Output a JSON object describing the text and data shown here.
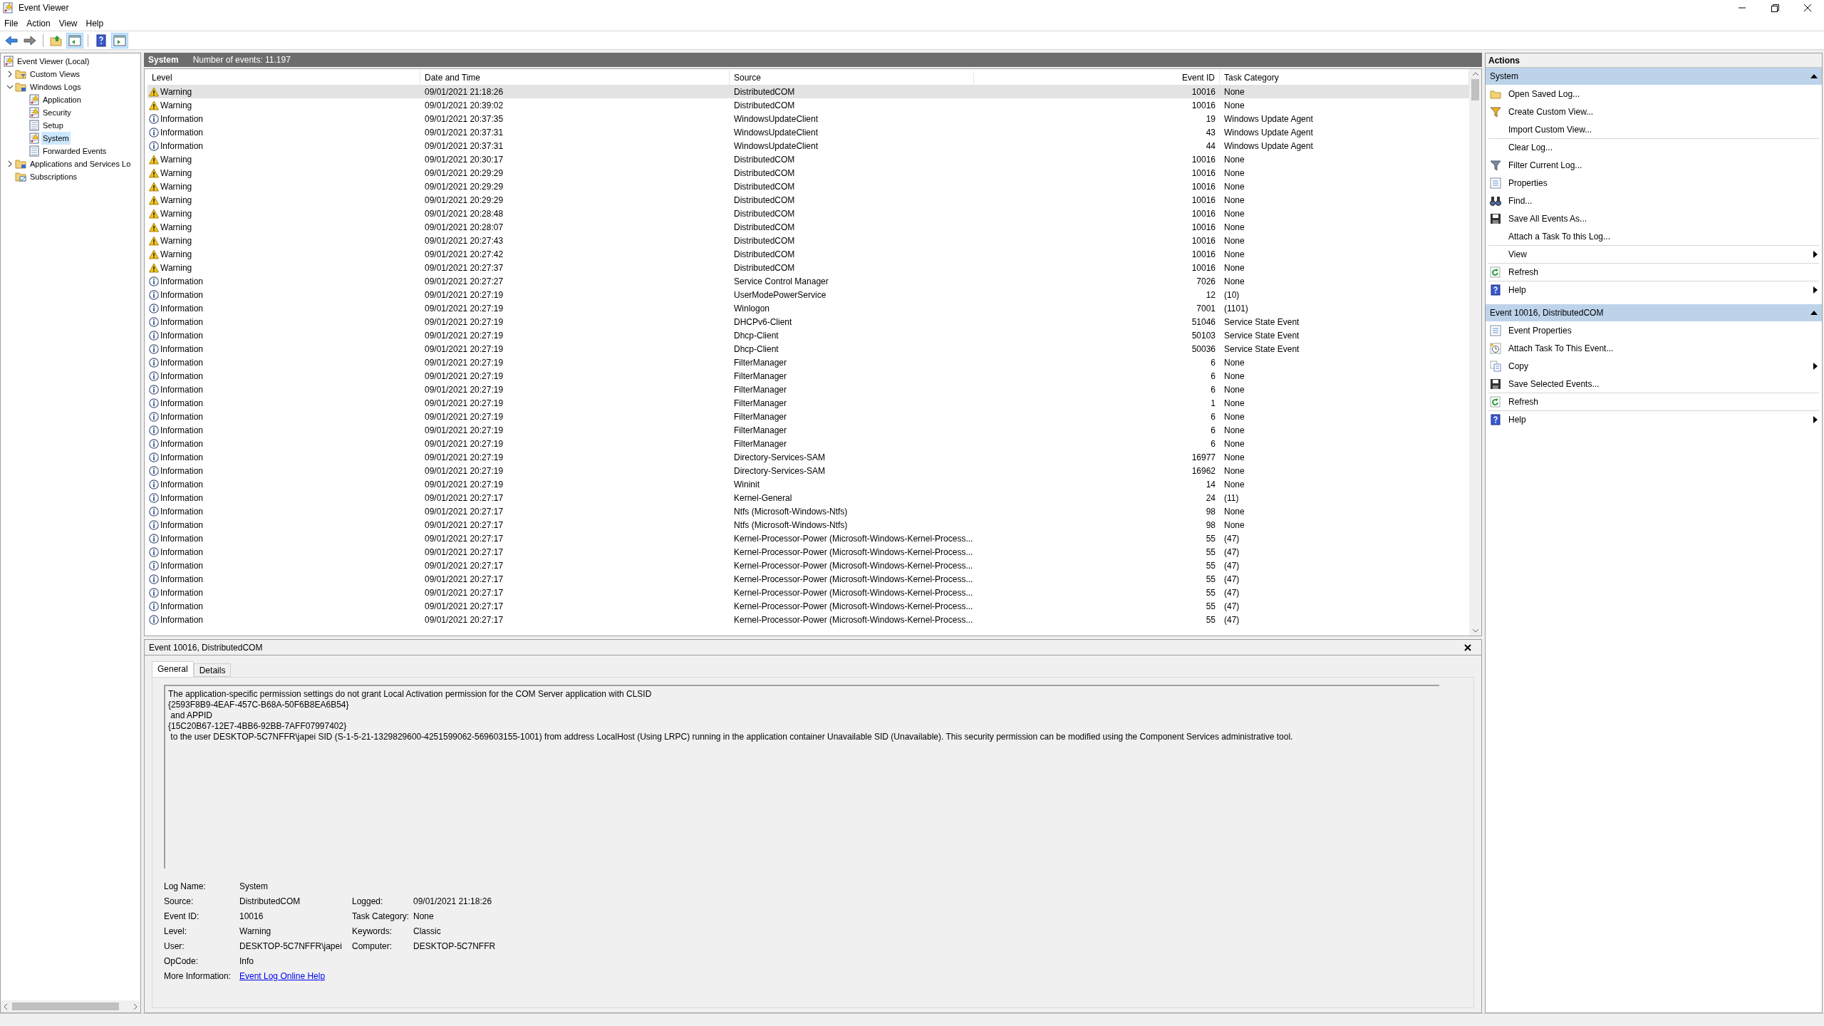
{
  "window": {
    "title": "Event Viewer"
  },
  "menu": [
    "File",
    "Action",
    "View",
    "Help"
  ],
  "toolbar": [
    {
      "kind": "back",
      "pressed": false
    },
    {
      "kind": "forward",
      "pressed": false
    },
    {
      "kind": "separator"
    },
    {
      "kind": "up",
      "pressed": false
    },
    {
      "kind": "tree",
      "pressed": true
    },
    {
      "kind": "separator"
    },
    {
      "kind": "help",
      "pressed": false
    },
    {
      "kind": "pane",
      "pressed": true
    }
  ],
  "tree": [
    {
      "label": "Event Viewer (Local)",
      "kind": "log",
      "selected": false,
      "children": [
        {
          "label": "Custom Views",
          "kind": "filter-folder",
          "expanded": false,
          "selected": false
        },
        {
          "label": "Windows Logs",
          "kind": "folder",
          "expanded": true,
          "selected": false,
          "children": [
            {
              "label": "Application",
              "kind": "log",
              "selected": false
            },
            {
              "label": "Security",
              "kind": "log",
              "selected": false
            },
            {
              "label": "Setup",
              "kind": "plain-log",
              "selected": false
            },
            {
              "label": "System",
              "kind": "log",
              "selected": true
            },
            {
              "label": "Forwarded Events",
              "kind": "plain-log",
              "selected": false
            }
          ]
        },
        {
          "label": "Applications and Services Lo",
          "kind": "folder",
          "expanded": false,
          "selected": false
        },
        {
          "label": "Subscriptions",
          "kind": "subscription",
          "selected": false
        }
      ]
    }
  ],
  "log_header": {
    "title": "System",
    "count": "Number of events: 11.197"
  },
  "table": {
    "columns": [
      "Level",
      "Date and Time",
      "Source",
      "Event ID",
      "Task Category"
    ],
    "rows": [
      {
        "kind": "warning",
        "level": "Warning",
        "date": "09/01/2021 21:18:26",
        "source": "DistributedCOM",
        "event_id": "10016",
        "category": "None",
        "selected": true
      },
      {
        "kind": "warning",
        "level": "Warning",
        "date": "09/01/2021 20:39:02",
        "source": "DistributedCOM",
        "event_id": "10016",
        "category": "None",
        "selected": false
      },
      {
        "kind": "info",
        "level": "Information",
        "date": "09/01/2021 20:37:35",
        "source": "WindowsUpdateClient",
        "event_id": "19",
        "category": "Windows Update Agent",
        "selected": false
      },
      {
        "kind": "info",
        "level": "Information",
        "date": "09/01/2021 20:37:31",
        "source": "WindowsUpdateClient",
        "event_id": "43",
        "category": "Windows Update Agent",
        "selected": false
      },
      {
        "kind": "info",
        "level": "Information",
        "date": "09/01/2021 20:37:31",
        "source": "WindowsUpdateClient",
        "event_id": "44",
        "category": "Windows Update Agent",
        "selected": false
      },
      {
        "kind": "warning",
        "level": "Warning",
        "date": "09/01/2021 20:30:17",
        "source": "DistributedCOM",
        "event_id": "10016",
        "category": "None",
        "selected": false
      },
      {
        "kind": "warning",
        "level": "Warning",
        "date": "09/01/2021 20:29:29",
        "source": "DistributedCOM",
        "event_id": "10016",
        "category": "None",
        "selected": false
      },
      {
        "kind": "warning",
        "level": "Warning",
        "date": "09/01/2021 20:29:29",
        "source": "DistributedCOM",
        "event_id": "10016",
        "category": "None",
        "selected": false
      },
      {
        "kind": "warning",
        "level": "Warning",
        "date": "09/01/2021 20:29:29",
        "source": "DistributedCOM",
        "event_id": "10016",
        "category": "None",
        "selected": false
      },
      {
        "kind": "warning",
        "level": "Warning",
        "date": "09/01/2021 20:28:48",
        "source": "DistributedCOM",
        "event_id": "10016",
        "category": "None",
        "selected": false
      },
      {
        "kind": "warning",
        "level": "Warning",
        "date": "09/01/2021 20:28:07",
        "source": "DistributedCOM",
        "event_id": "10016",
        "category": "None",
        "selected": false
      },
      {
        "kind": "warning",
        "level": "Warning",
        "date": "09/01/2021 20:27:43",
        "source": "DistributedCOM",
        "event_id": "10016",
        "category": "None",
        "selected": false
      },
      {
        "kind": "warning",
        "level": "Warning",
        "date": "09/01/2021 20:27:42",
        "source": "DistributedCOM",
        "event_id": "10016",
        "category": "None",
        "selected": false
      },
      {
        "kind": "warning",
        "level": "Warning",
        "date": "09/01/2021 20:27:37",
        "source": "DistributedCOM",
        "event_id": "10016",
        "category": "None",
        "selected": false
      },
      {
        "kind": "info",
        "level": "Information",
        "date": "09/01/2021 20:27:27",
        "source": "Service Control Manager",
        "event_id": "7026",
        "category": "None",
        "selected": false
      },
      {
        "kind": "info",
        "level": "Information",
        "date": "09/01/2021 20:27:19",
        "source": "UserModePowerService",
        "event_id": "12",
        "category": "(10)",
        "selected": false
      },
      {
        "kind": "info",
        "level": "Information",
        "date": "09/01/2021 20:27:19",
        "source": "Winlogon",
        "event_id": "7001",
        "category": "(1101)",
        "selected": false
      },
      {
        "kind": "info",
        "level": "Information",
        "date": "09/01/2021 20:27:19",
        "source": "DHCPv6-Client",
        "event_id": "51046",
        "category": "Service State Event",
        "selected": false
      },
      {
        "kind": "info",
        "level": "Information",
        "date": "09/01/2021 20:27:19",
        "source": "Dhcp-Client",
        "event_id": "50103",
        "category": "Service State Event",
        "selected": false
      },
      {
        "kind": "info",
        "level": "Information",
        "date": "09/01/2021 20:27:19",
        "source": "Dhcp-Client",
        "event_id": "50036",
        "category": "Service State Event",
        "selected": false
      },
      {
        "kind": "info",
        "level": "Information",
        "date": "09/01/2021 20:27:19",
        "source": "FilterManager",
        "event_id": "6",
        "category": "None",
        "selected": false
      },
      {
        "kind": "info",
        "level": "Information",
        "date": "09/01/2021 20:27:19",
        "source": "FilterManager",
        "event_id": "6",
        "category": "None",
        "selected": false
      },
      {
        "kind": "info",
        "level": "Information",
        "date": "09/01/2021 20:27:19",
        "source": "FilterManager",
        "event_id": "6",
        "category": "None",
        "selected": false
      },
      {
        "kind": "info",
        "level": "Information",
        "date": "09/01/2021 20:27:19",
        "source": "FilterManager",
        "event_id": "1",
        "category": "None",
        "selected": false
      },
      {
        "kind": "info",
        "level": "Information",
        "date": "09/01/2021 20:27:19",
        "source": "FilterManager",
        "event_id": "6",
        "category": "None",
        "selected": false
      },
      {
        "kind": "info",
        "level": "Information",
        "date": "09/01/2021 20:27:19",
        "source": "FilterManager",
        "event_id": "6",
        "category": "None",
        "selected": false
      },
      {
        "kind": "info",
        "level": "Information",
        "date": "09/01/2021 20:27:19",
        "source": "FilterManager",
        "event_id": "6",
        "category": "None",
        "selected": false
      },
      {
        "kind": "info",
        "level": "Information",
        "date": "09/01/2021 20:27:19",
        "source": "Directory-Services-SAM",
        "event_id": "16977",
        "category": "None",
        "selected": false
      },
      {
        "kind": "info",
        "level": "Information",
        "date": "09/01/2021 20:27:19",
        "source": "Directory-Services-SAM",
        "event_id": "16962",
        "category": "None",
        "selected": false
      },
      {
        "kind": "info",
        "level": "Information",
        "date": "09/01/2021 20:27:19",
        "source": "Wininit",
        "event_id": "14",
        "category": "None",
        "selected": false
      },
      {
        "kind": "info",
        "level": "Information",
        "date": "09/01/2021 20:27:17",
        "source": "Kernel-General",
        "event_id": "24",
        "category": "(11)",
        "selected": false
      },
      {
        "kind": "info",
        "level": "Information",
        "date": "09/01/2021 20:27:17",
        "source": "Ntfs (Microsoft-Windows-Ntfs)",
        "event_id": "98",
        "category": "None",
        "selected": false
      },
      {
        "kind": "info",
        "level": "Information",
        "date": "09/01/2021 20:27:17",
        "source": "Ntfs (Microsoft-Windows-Ntfs)",
        "event_id": "98",
        "category": "None",
        "selected": false
      },
      {
        "kind": "info",
        "level": "Information",
        "date": "09/01/2021 20:27:17",
        "source": "Kernel-Processor-Power (Microsoft-Windows-Kernel-Process...",
        "event_id": "55",
        "category": "(47)",
        "selected": false
      },
      {
        "kind": "info",
        "level": "Information",
        "date": "09/01/2021 20:27:17",
        "source": "Kernel-Processor-Power (Microsoft-Windows-Kernel-Process...",
        "event_id": "55",
        "category": "(47)",
        "selected": false
      },
      {
        "kind": "info",
        "level": "Information",
        "date": "09/01/2021 20:27:17",
        "source": "Kernel-Processor-Power (Microsoft-Windows-Kernel-Process...",
        "event_id": "55",
        "category": "(47)",
        "selected": false
      },
      {
        "kind": "info",
        "level": "Information",
        "date": "09/01/2021 20:27:17",
        "source": "Kernel-Processor-Power (Microsoft-Windows-Kernel-Process...",
        "event_id": "55",
        "category": "(47)",
        "selected": false
      },
      {
        "kind": "info",
        "level": "Information",
        "date": "09/01/2021 20:27:17",
        "source": "Kernel-Processor-Power (Microsoft-Windows-Kernel-Process...",
        "event_id": "55",
        "category": "(47)",
        "selected": false
      },
      {
        "kind": "info",
        "level": "Information",
        "date": "09/01/2021 20:27:17",
        "source": "Kernel-Processor-Power (Microsoft-Windows-Kernel-Process...",
        "event_id": "55",
        "category": "(47)",
        "selected": false
      },
      {
        "kind": "info",
        "level": "Information",
        "date": "09/01/2021 20:27:17",
        "source": "Kernel-Processor-Power (Microsoft-Windows-Kernel-Process...",
        "event_id": "55",
        "category": "(47)",
        "selected": false
      }
    ]
  },
  "details": {
    "title": "Event 10016, DistributedCOM",
    "tabs": [
      {
        "label": "General",
        "selected": true
      },
      {
        "label": "Details",
        "selected": false
      }
    ],
    "message": [
      "The application-specific permission settings do not grant Local Activation permission for the COM Server application with CLSID",
      "{2593F8B9-4EAF-457C-B68A-50F6B8EA6B54}",
      " and APPID",
      "{15C20B67-12E7-4BB6-92BB-7AFF07997402}",
      " to the user DESKTOP-5C7NFFR\\japei SID (S-1-5-21-1329829600-4251599062-569603155-1001) from address LocalHost (Using LRPC) running in the application container Unavailable SID (Unavailable). This security permission can be modified using the Component Services administrative tool."
    ],
    "fields": [
      [
        {
          "label": "Log Name:",
          "value": "System"
        }
      ],
      [
        {
          "label": "Source:",
          "value": "DistributedCOM"
        },
        {
          "label": "Logged:",
          "value": "09/01/2021 21:18:26"
        }
      ],
      [
        {
          "label": "Event ID:",
          "value": "10016"
        },
        {
          "label": "Task Category:",
          "value": "None"
        }
      ],
      [
        {
          "label": "Level:",
          "value": "Warning"
        },
        {
          "label": "Keywords:",
          "value": "Classic"
        }
      ],
      [
        {
          "label": "User:",
          "value": "DESKTOP-5C7NFFR\\japei"
        },
        {
          "label": "Computer:",
          "value": "DESKTOP-5C7NFFR"
        }
      ],
      [
        {
          "label": "OpCode:",
          "value": "Info"
        }
      ],
      [
        {
          "label": "More Information:",
          "value": "Event Log Online Help",
          "kind": "link"
        }
      ]
    ]
  },
  "actions": {
    "title": "Actions",
    "sections": [
      {
        "title": "System",
        "expanded": true,
        "items": [
          {
            "label": "Open Saved Log...",
            "kind": "folder",
            "divider": false,
            "submenu": false
          },
          {
            "label": "Create Custom View...",
            "kind": "funnel",
            "divider": false,
            "submenu": false
          },
          {
            "label": "Import Custom View...",
            "kind": "none",
            "divider": false,
            "submenu": false
          },
          {
            "label": "Clear Log...",
            "kind": "none",
            "divider": true,
            "submenu": false
          },
          {
            "label": "Filter Current Log...",
            "kind": "filter",
            "divider": false,
            "submenu": false
          },
          {
            "label": "Properties",
            "kind": "properties",
            "divider": false,
            "submenu": false
          },
          {
            "label": "Find...",
            "kind": "binoculars",
            "divider": false,
            "submenu": false
          },
          {
            "label": "Save All Events As...",
            "kind": "disk",
            "divider": false,
            "submenu": false
          },
          {
            "label": "Attach a Task To this Log...",
            "kind": "none",
            "divider": false,
            "submenu": false
          },
          {
            "label": "View",
            "kind": "none",
            "divider": true,
            "submenu": true
          },
          {
            "label": "Refresh",
            "kind": "refresh",
            "divider": true,
            "submenu": false
          },
          {
            "label": "Help",
            "kind": "help",
            "divider": true,
            "submenu": true
          }
        ]
      },
      {
        "title": "Event 10016, DistributedCOM",
        "expanded": true,
        "items": [
          {
            "label": "Event Properties",
            "kind": "properties",
            "divider": false,
            "submenu": false
          },
          {
            "label": "Attach Task To This Event...",
            "kind": "clock",
            "divider": false,
            "submenu": false
          },
          {
            "label": "Copy",
            "kind": "copy",
            "divider": false,
            "submenu": true
          },
          {
            "label": "Save Selected Events...",
            "kind": "disk",
            "divider": false,
            "submenu": false
          },
          {
            "label": "Refresh",
            "kind": "refresh",
            "divider": true,
            "submenu": false
          },
          {
            "label": "Help",
            "kind": "help",
            "divider": true,
            "submenu": true
          }
        ]
      }
    ]
  }
}
